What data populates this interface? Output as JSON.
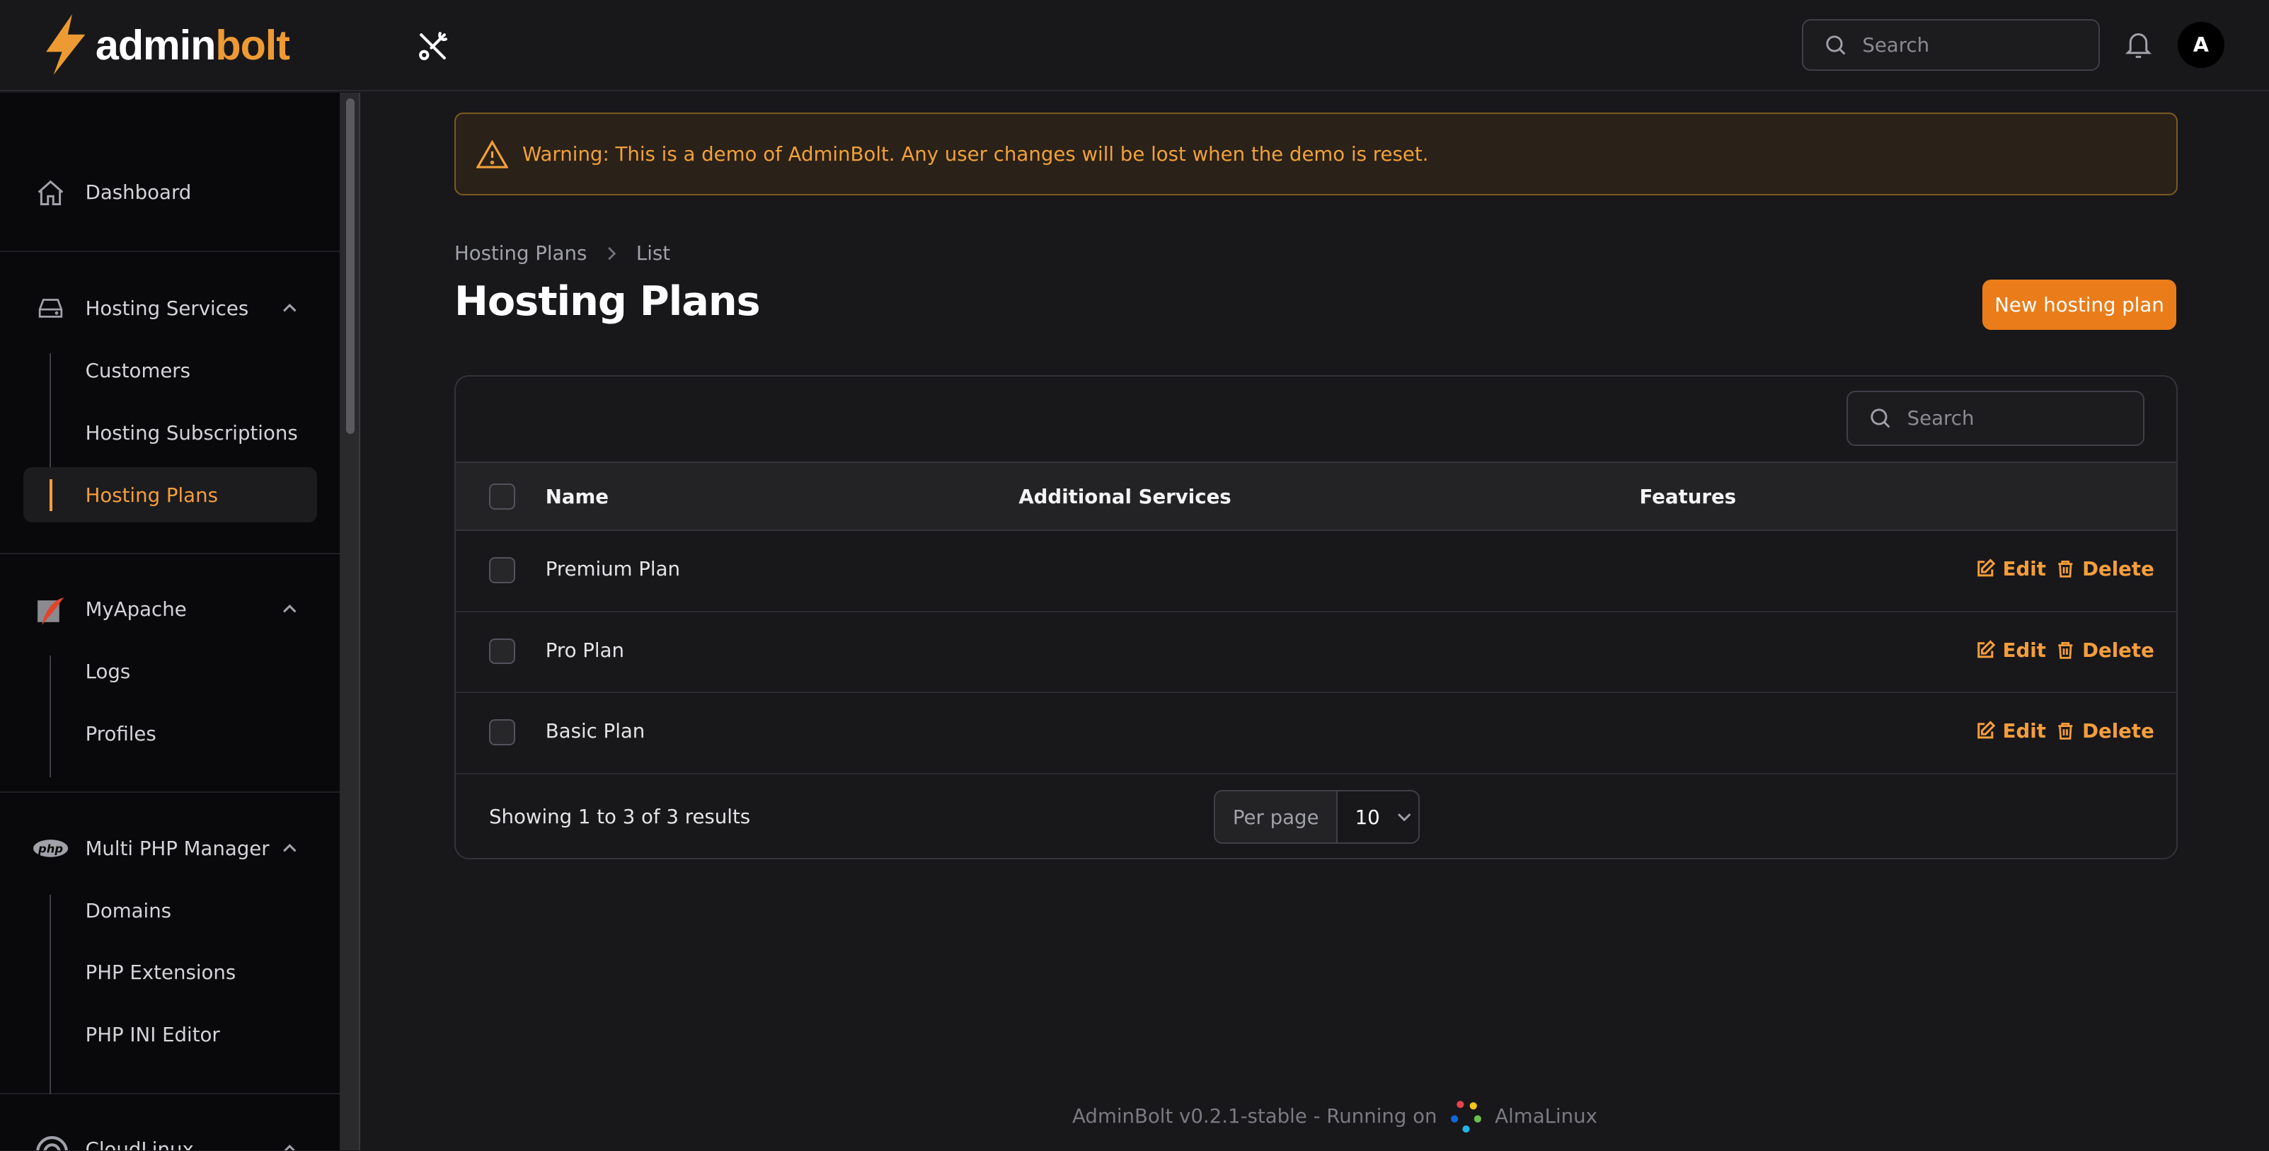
{
  "brand": {
    "name_white": "admin",
    "name_orange": "bolt",
    "accent": "#ed9a33"
  },
  "topbar": {
    "search_placeholder": "Search",
    "avatar_initial": "A"
  },
  "sidebar": {
    "dashboard": "Dashboard",
    "groups": [
      {
        "label": "Hosting Services",
        "icon": "server-icon",
        "items": [
          "Customers",
          "Hosting Subscriptions",
          "Hosting Plans"
        ],
        "active": "Hosting Plans"
      },
      {
        "label": "MyApache",
        "icon": "apache-feather-icon",
        "items": [
          "Logs",
          "Profiles"
        ]
      },
      {
        "label": "Multi PHP Manager",
        "icon": "php-icon",
        "items": [
          "Domains",
          "PHP Extensions",
          "PHP INI Editor"
        ]
      },
      {
        "label": "CloudLinux",
        "icon": "cloudlinux-icon",
        "items": []
      }
    ]
  },
  "warning": "Warning: This is a demo of AdminBolt. Any user changes will be lost when the demo is reset.",
  "breadcrumb": [
    "Hosting Plans",
    "List"
  ],
  "page_title": "Hosting Plans",
  "new_button": "New hosting plan",
  "table": {
    "search_placeholder": "Search",
    "columns": [
      "Name",
      "Additional Services",
      "Features"
    ],
    "rows": [
      {
        "name": "Premium Plan"
      },
      {
        "name": "Pro Plan"
      },
      {
        "name": "Basic Plan"
      }
    ],
    "edit_label": "Edit",
    "delete_label": "Delete",
    "summary": "Showing 1 to 3 of 3 results",
    "per_page_label": "Per page",
    "per_page_value": "10"
  },
  "footer": {
    "text": "AdminBolt v0.2.1-stable - Running on",
    "os": "AlmaLinux"
  }
}
